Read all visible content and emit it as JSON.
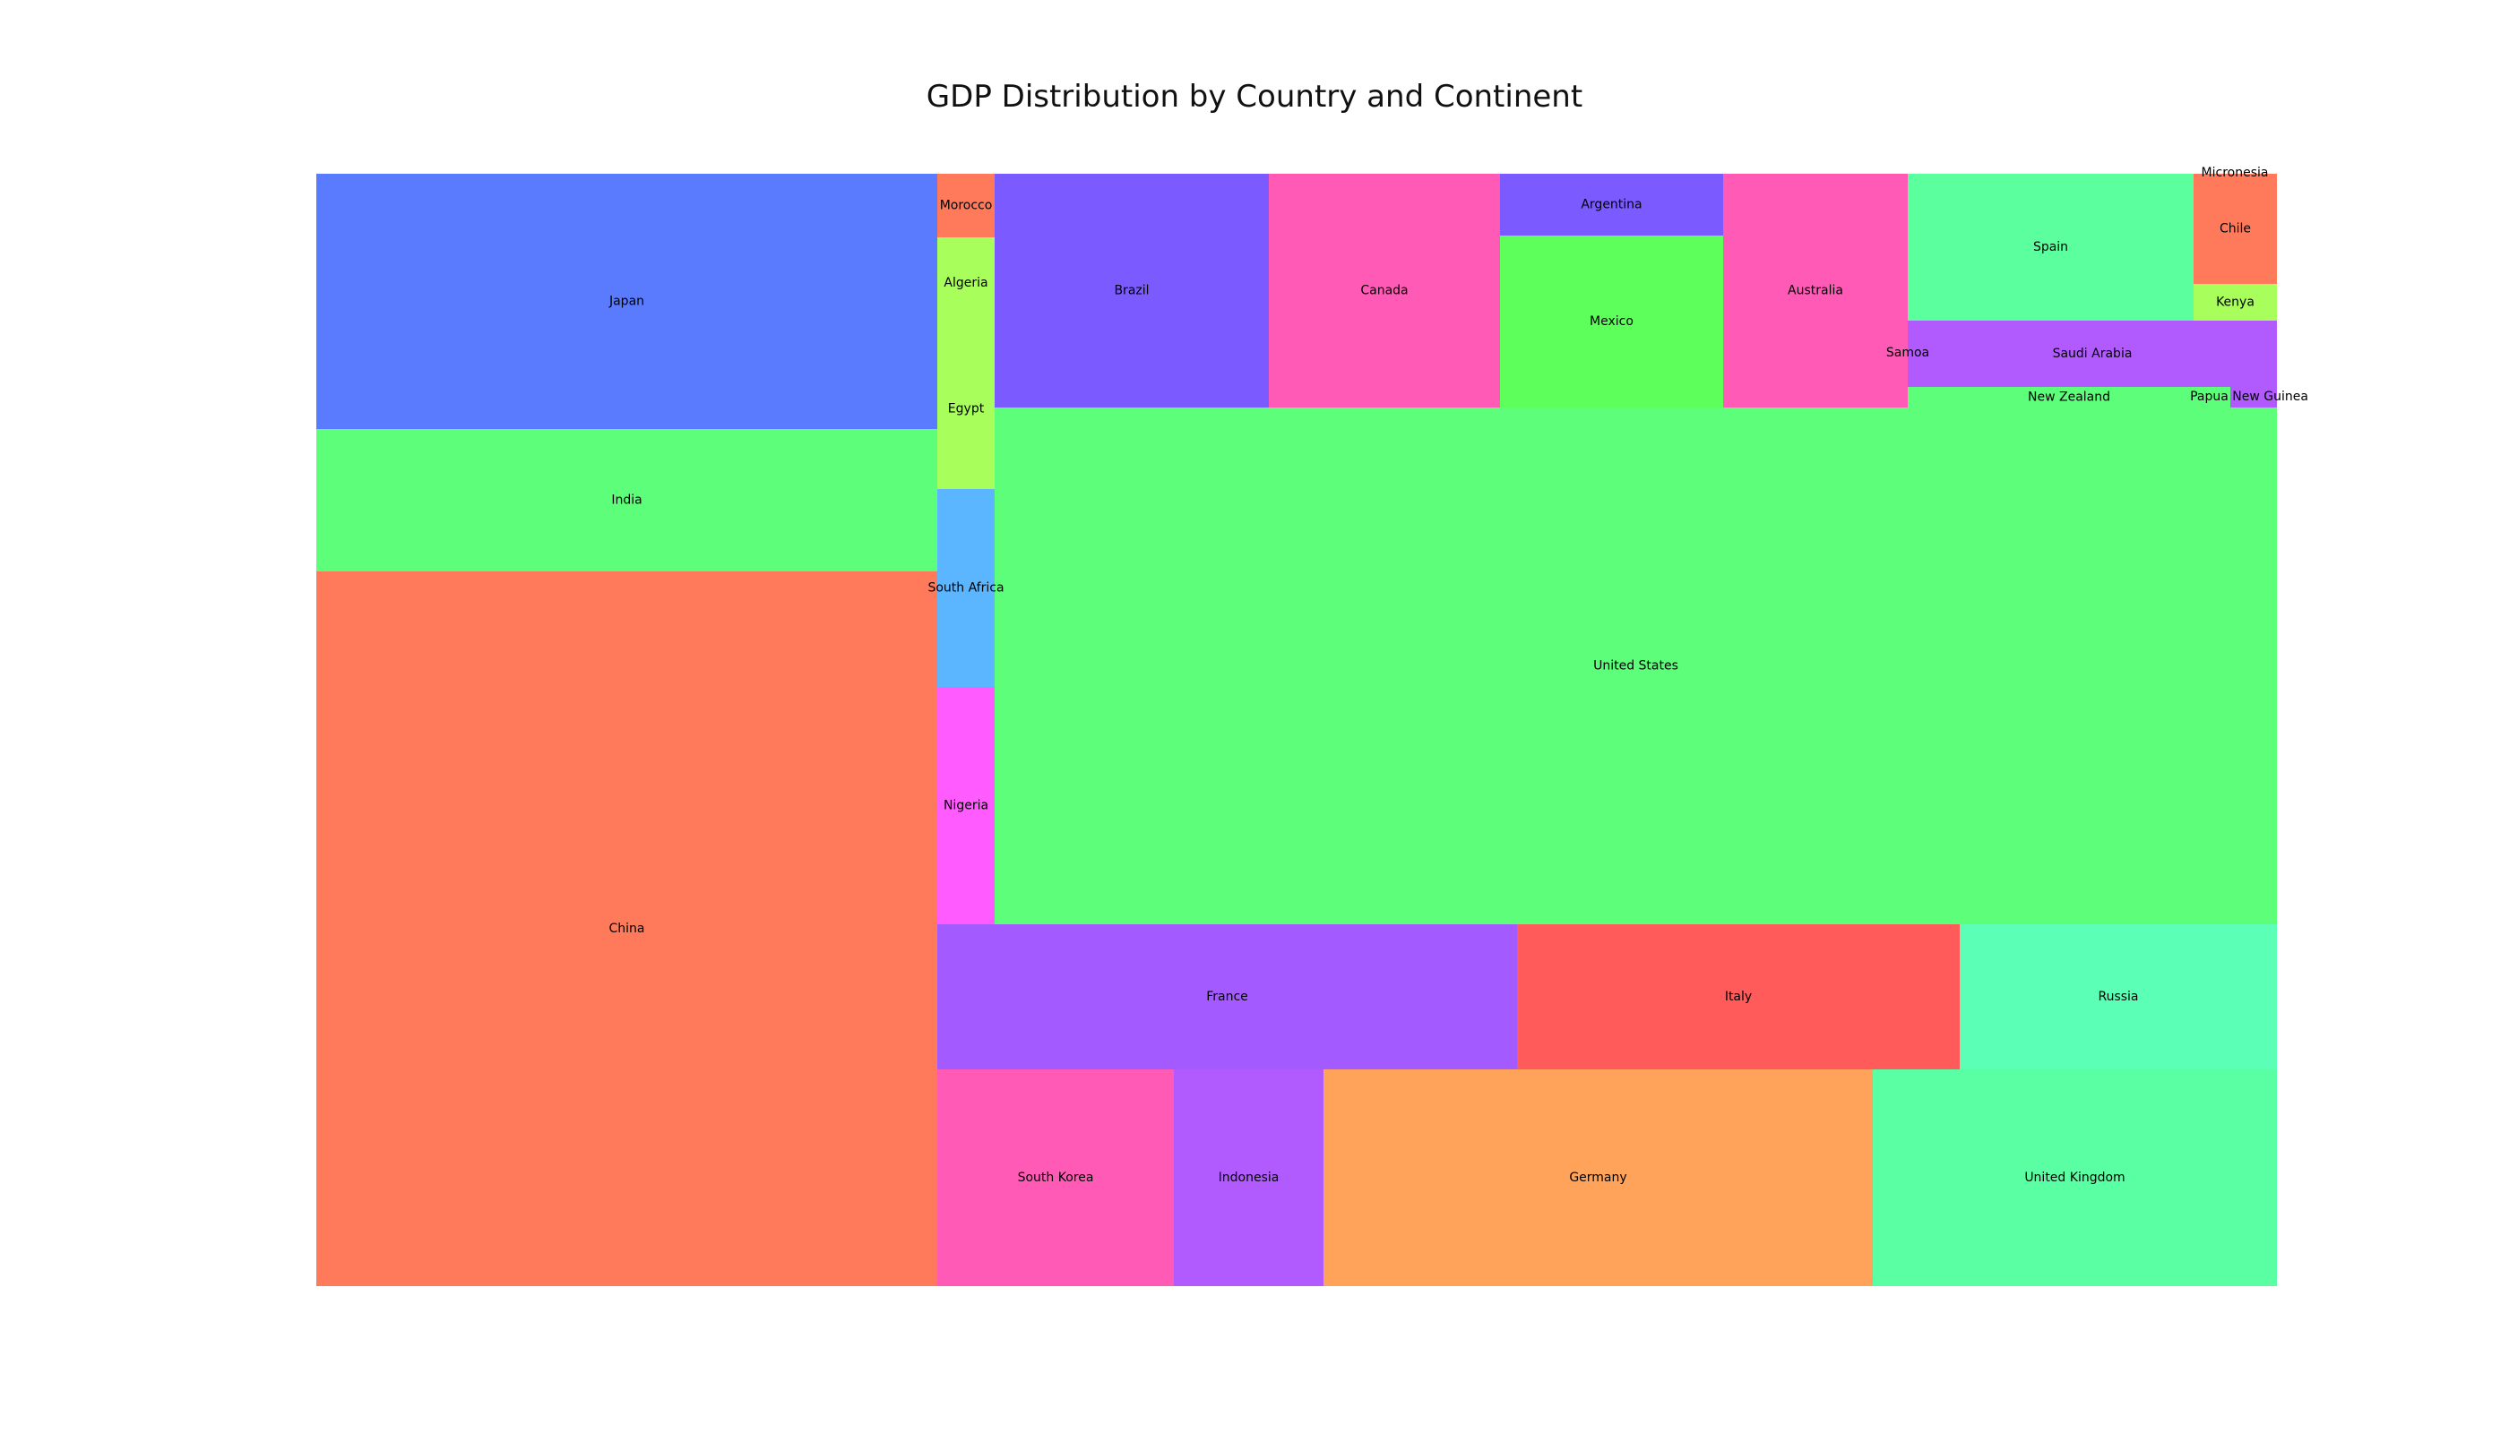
{
  "chart_data": {
    "type": "treemap",
    "title": "GDP Distribution by Country and Continent",
    "tiles": [
      {
        "label": "Japan",
        "color": "#5b7bff"
      },
      {
        "label": "India",
        "color": "#5dff7a"
      },
      {
        "label": "China",
        "color": "#ff7a5b"
      },
      {
        "label": "Morocco",
        "color": "#ff7a5b"
      },
      {
        "label": "Algeria",
        "color": "#a8ff5b"
      },
      {
        "label": "Egypt",
        "color": "#a8ff5b"
      },
      {
        "label": "South Africa",
        "color": "#5bb6ff"
      },
      {
        "label": "Nigeria",
        "color": "#ff5bff"
      },
      {
        "label": "Brazil",
        "color": "#7b5bff"
      },
      {
        "label": "Canada",
        "color": "#ff5bb6"
      },
      {
        "label": "Argentina",
        "color": "#7b5bff"
      },
      {
        "label": "Mexico",
        "color": "#5dff5b"
      },
      {
        "label": "Australia",
        "color": "#ff5bb6"
      },
      {
        "label": "Spain",
        "color": "#5bff9e"
      },
      {
        "label": "Micronesia",
        "color": "#ff7a5b"
      },
      {
        "label": "Chile",
        "color": "#ff7a5b"
      },
      {
        "label": "Kenya",
        "color": "#a8ff5b"
      },
      {
        "label": "Samoa",
        "color": "#b15bff"
      },
      {
        "label": "Saudi Arabia",
        "color": "#b15bff"
      },
      {
        "label": "New Zealand",
        "color": "#5dff7a"
      },
      {
        "label": "Papua New Guinea",
        "color": "#b15bff"
      },
      {
        "label": "United States",
        "color": "#5dff7a"
      },
      {
        "label": "France",
        "color": "#a35bff"
      },
      {
        "label": "Italy",
        "color": "#ff5b5b"
      },
      {
        "label": "Russia",
        "color": "#5bffb6"
      },
      {
        "label": "South Korea",
        "color": "#ff5bb6"
      },
      {
        "label": "Indonesia",
        "color": "#b15bff"
      },
      {
        "label": "Germany",
        "color": "#ffa35b"
      },
      {
        "label": "United Kingdom",
        "color": "#5bffa3"
      }
    ]
  }
}
